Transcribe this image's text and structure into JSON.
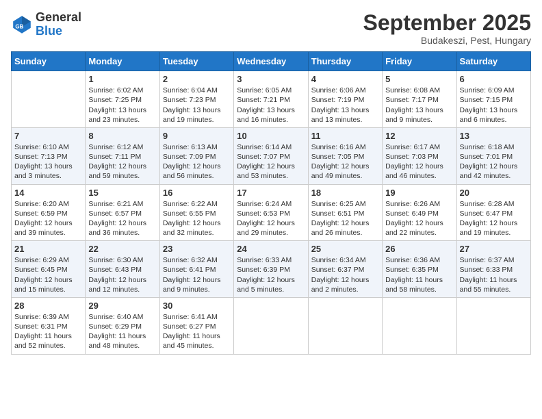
{
  "header": {
    "logo_general": "General",
    "logo_blue": "Blue",
    "month_title": "September 2025",
    "subtitle": "Budakeszi, Pest, Hungary"
  },
  "days_of_week": [
    "Sunday",
    "Monday",
    "Tuesday",
    "Wednesday",
    "Thursday",
    "Friday",
    "Saturday"
  ],
  "weeks": [
    [
      {
        "day": "",
        "sunrise": "",
        "sunset": "",
        "daylight": ""
      },
      {
        "day": "1",
        "sunrise": "Sunrise: 6:02 AM",
        "sunset": "Sunset: 7:25 PM",
        "daylight": "Daylight: 13 hours and 23 minutes."
      },
      {
        "day": "2",
        "sunrise": "Sunrise: 6:04 AM",
        "sunset": "Sunset: 7:23 PM",
        "daylight": "Daylight: 13 hours and 19 minutes."
      },
      {
        "day": "3",
        "sunrise": "Sunrise: 6:05 AM",
        "sunset": "Sunset: 7:21 PM",
        "daylight": "Daylight: 13 hours and 16 minutes."
      },
      {
        "day": "4",
        "sunrise": "Sunrise: 6:06 AM",
        "sunset": "Sunset: 7:19 PM",
        "daylight": "Daylight: 13 hours and 13 minutes."
      },
      {
        "day": "5",
        "sunrise": "Sunrise: 6:08 AM",
        "sunset": "Sunset: 7:17 PM",
        "daylight": "Daylight: 13 hours and 9 minutes."
      },
      {
        "day": "6",
        "sunrise": "Sunrise: 6:09 AM",
        "sunset": "Sunset: 7:15 PM",
        "daylight": "Daylight: 13 hours and 6 minutes."
      }
    ],
    [
      {
        "day": "7",
        "sunrise": "Sunrise: 6:10 AM",
        "sunset": "Sunset: 7:13 PM",
        "daylight": "Daylight: 13 hours and 3 minutes."
      },
      {
        "day": "8",
        "sunrise": "Sunrise: 6:12 AM",
        "sunset": "Sunset: 7:11 PM",
        "daylight": "Daylight: 12 hours and 59 minutes."
      },
      {
        "day": "9",
        "sunrise": "Sunrise: 6:13 AM",
        "sunset": "Sunset: 7:09 PM",
        "daylight": "Daylight: 12 hours and 56 minutes."
      },
      {
        "day": "10",
        "sunrise": "Sunrise: 6:14 AM",
        "sunset": "Sunset: 7:07 PM",
        "daylight": "Daylight: 12 hours and 53 minutes."
      },
      {
        "day": "11",
        "sunrise": "Sunrise: 6:16 AM",
        "sunset": "Sunset: 7:05 PM",
        "daylight": "Daylight: 12 hours and 49 minutes."
      },
      {
        "day": "12",
        "sunrise": "Sunrise: 6:17 AM",
        "sunset": "Sunset: 7:03 PM",
        "daylight": "Daylight: 12 hours and 46 minutes."
      },
      {
        "day": "13",
        "sunrise": "Sunrise: 6:18 AM",
        "sunset": "Sunset: 7:01 PM",
        "daylight": "Daylight: 12 hours and 42 minutes."
      }
    ],
    [
      {
        "day": "14",
        "sunrise": "Sunrise: 6:20 AM",
        "sunset": "Sunset: 6:59 PM",
        "daylight": "Daylight: 12 hours and 39 minutes."
      },
      {
        "day": "15",
        "sunrise": "Sunrise: 6:21 AM",
        "sunset": "Sunset: 6:57 PM",
        "daylight": "Daylight: 12 hours and 36 minutes."
      },
      {
        "day": "16",
        "sunrise": "Sunrise: 6:22 AM",
        "sunset": "Sunset: 6:55 PM",
        "daylight": "Daylight: 12 hours and 32 minutes."
      },
      {
        "day": "17",
        "sunrise": "Sunrise: 6:24 AM",
        "sunset": "Sunset: 6:53 PM",
        "daylight": "Daylight: 12 hours and 29 minutes."
      },
      {
        "day": "18",
        "sunrise": "Sunrise: 6:25 AM",
        "sunset": "Sunset: 6:51 PM",
        "daylight": "Daylight: 12 hours and 26 minutes."
      },
      {
        "day": "19",
        "sunrise": "Sunrise: 6:26 AM",
        "sunset": "Sunset: 6:49 PM",
        "daylight": "Daylight: 12 hours and 22 minutes."
      },
      {
        "day": "20",
        "sunrise": "Sunrise: 6:28 AM",
        "sunset": "Sunset: 6:47 PM",
        "daylight": "Daylight: 12 hours and 19 minutes."
      }
    ],
    [
      {
        "day": "21",
        "sunrise": "Sunrise: 6:29 AM",
        "sunset": "Sunset: 6:45 PM",
        "daylight": "Daylight: 12 hours and 15 minutes."
      },
      {
        "day": "22",
        "sunrise": "Sunrise: 6:30 AM",
        "sunset": "Sunset: 6:43 PM",
        "daylight": "Daylight: 12 hours and 12 minutes."
      },
      {
        "day": "23",
        "sunrise": "Sunrise: 6:32 AM",
        "sunset": "Sunset: 6:41 PM",
        "daylight": "Daylight: 12 hours and 9 minutes."
      },
      {
        "day": "24",
        "sunrise": "Sunrise: 6:33 AM",
        "sunset": "Sunset: 6:39 PM",
        "daylight": "Daylight: 12 hours and 5 minutes."
      },
      {
        "day": "25",
        "sunrise": "Sunrise: 6:34 AM",
        "sunset": "Sunset: 6:37 PM",
        "daylight": "Daylight: 12 hours and 2 minutes."
      },
      {
        "day": "26",
        "sunrise": "Sunrise: 6:36 AM",
        "sunset": "Sunset: 6:35 PM",
        "daylight": "Daylight: 11 hours and 58 minutes."
      },
      {
        "day": "27",
        "sunrise": "Sunrise: 6:37 AM",
        "sunset": "Sunset: 6:33 PM",
        "daylight": "Daylight: 11 hours and 55 minutes."
      }
    ],
    [
      {
        "day": "28",
        "sunrise": "Sunrise: 6:39 AM",
        "sunset": "Sunset: 6:31 PM",
        "daylight": "Daylight: 11 hours and 52 minutes."
      },
      {
        "day": "29",
        "sunrise": "Sunrise: 6:40 AM",
        "sunset": "Sunset: 6:29 PM",
        "daylight": "Daylight: 11 hours and 48 minutes."
      },
      {
        "day": "30",
        "sunrise": "Sunrise: 6:41 AM",
        "sunset": "Sunset: 6:27 PM",
        "daylight": "Daylight: 11 hours and 45 minutes."
      },
      {
        "day": "",
        "sunrise": "",
        "sunset": "",
        "daylight": ""
      },
      {
        "day": "",
        "sunrise": "",
        "sunset": "",
        "daylight": ""
      },
      {
        "day": "",
        "sunrise": "",
        "sunset": "",
        "daylight": ""
      },
      {
        "day": "",
        "sunrise": "",
        "sunset": "",
        "daylight": ""
      }
    ]
  ]
}
